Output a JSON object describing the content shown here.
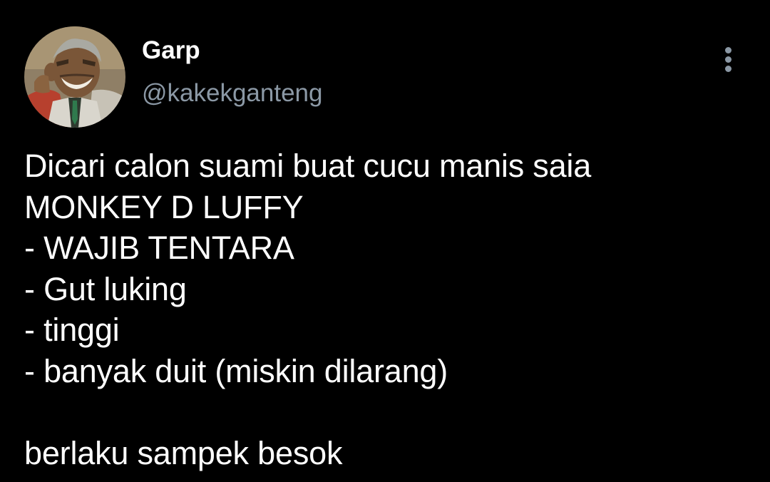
{
  "author": {
    "name": "Garp",
    "handle": "@kakekganteng",
    "avatar_description": "anime-style portrait avatar"
  },
  "menu": {
    "icon": "more-vertical-icon"
  },
  "tweet": {
    "lines": [
      "Dicari calon suami buat cucu manis saia",
      "MONKEY D LUFFY",
      "- WAJIB TENTARA",
      "- Gut luking",
      "- tinggi",
      "- banyak duit (miskin dilarang)",
      "",
      "berlaku sampek besok"
    ]
  },
  "colors": {
    "background": "#000000",
    "text_primary": "#ffffff",
    "text_secondary": "#8b98a5"
  }
}
